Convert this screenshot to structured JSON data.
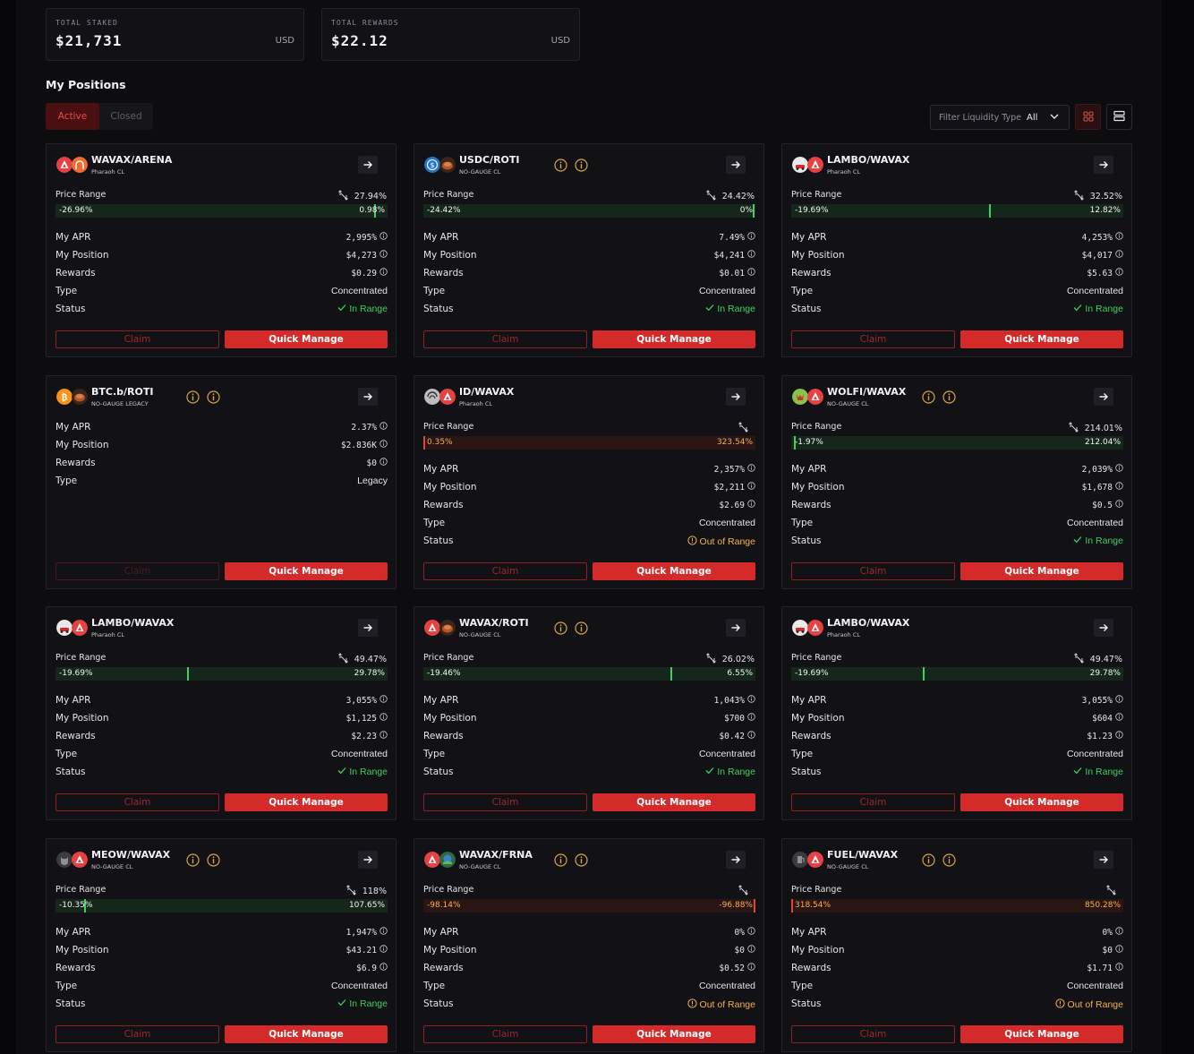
{
  "summary": {
    "staked": {
      "label": "TOTAL STAKED",
      "value": "$21,731",
      "unit": "USD"
    },
    "rewards": {
      "label": "TOTAL REWARDS",
      "value": "$22.12",
      "unit": "USD"
    }
  },
  "title": "My Positions",
  "tabs": {
    "active": "Active",
    "closed": "Closed"
  },
  "filter": {
    "label": "Filter Liquidity Type",
    "value": "All"
  },
  "labels": {
    "price_range": "Price Range",
    "apr": "My APR",
    "position": "My Position",
    "rewards": "Rewards",
    "type": "Type",
    "status": "Status",
    "claim": "Claim",
    "quick_manage": "Quick Manage"
  },
  "colors": {
    "accent": "#d42a2a",
    "in_range": "#3ed15e",
    "out_of_range": "#f5b14c",
    "background": "#0d0d10",
    "card": "#111116"
  },
  "positions": [
    {
      "pair": "WAVAX/ARENA",
      "sub": "Pharaoh CL",
      "tokens": [
        "avax",
        "arena"
      ],
      "info_icons": false,
      "range": {
        "width": "27.94%",
        "low": "-26.96%",
        "high": "0.98%",
        "in_range": true,
        "marker": 0.964
      },
      "apr": "2,995%",
      "position": "$4,273",
      "rewards": "$0.29",
      "type": "Concentrated",
      "status": "In Range",
      "status_ok": true,
      "claim_enabled": true
    },
    {
      "pair": "USDC/ROTI",
      "sub": "NO-GAUGE CL",
      "tokens": [
        "usdc",
        "roti"
      ],
      "info_icons": true,
      "range": {
        "width": "24.42%",
        "low": "-24.42%",
        "high": "0%",
        "in_range": true,
        "marker": 0.996
      },
      "apr": "7.49%",
      "position": "$4,241",
      "rewards": "$0.01",
      "type": "Concentrated",
      "status": "In Range",
      "status_ok": true,
      "claim_enabled": true
    },
    {
      "pair": "LAMBO/WAVAX",
      "sub": "Pharaoh CL",
      "tokens": [
        "lambo",
        "avax"
      ],
      "info_icons": false,
      "range": {
        "width": "32.52%",
        "low": "-19.69%",
        "high": "12.82%",
        "in_range": true,
        "marker": 0.599
      },
      "apr": "4,253%",
      "position": "$4,017",
      "rewards": "$5.63",
      "type": "Concentrated",
      "status": "In Range",
      "status_ok": true,
      "claim_enabled": true
    },
    {
      "pair": "BTC.b/ROTI",
      "sub": "NO-GAUGE LEGACY",
      "tokens": [
        "btc",
        "roti"
      ],
      "info_icons": true,
      "range": null,
      "apr": "2.37%",
      "position": "$2.836K",
      "rewards": "$0",
      "type": "Legacy",
      "status": null,
      "status_ok": true,
      "claim_enabled": false
    },
    {
      "pair": "ID/WAVAX",
      "sub": "Pharaoh CL",
      "tokens": [
        "id",
        "avax"
      ],
      "info_icons": false,
      "range": {
        "width": "",
        "low": "0.35%",
        "high": "323.54%",
        "in_range": false,
        "marker": 0.0
      },
      "apr": "2,357%",
      "position": "$2,211",
      "rewards": "$2.69",
      "type": "Concentrated",
      "status": "Out of Range",
      "status_ok": false,
      "claim_enabled": true
    },
    {
      "pair": "WOLFI/WAVAX",
      "sub": "NO-GAUGE CL",
      "tokens": [
        "wolfi",
        "avax"
      ],
      "info_icons": true,
      "range": {
        "width": "214.01%",
        "low": "-1.97%",
        "high": "212.04%",
        "in_range": true,
        "marker": 0.009
      },
      "apr": "2,039%",
      "position": "$1,678",
      "rewards": "$0.5",
      "type": "Concentrated",
      "status": "In Range",
      "status_ok": true,
      "claim_enabled": true
    },
    {
      "pair": "LAMBO/WAVAX",
      "sub": "Pharaoh CL",
      "tokens": [
        "lambo",
        "avax"
      ],
      "info_icons": false,
      "range": {
        "width": "49.47%",
        "low": "-19.69%",
        "high": "29.78%",
        "in_range": true,
        "marker": 0.398
      },
      "apr": "3,055%",
      "position": "$1,125",
      "rewards": "$2.23",
      "type": "Concentrated",
      "status": "In Range",
      "status_ok": true,
      "claim_enabled": true
    },
    {
      "pair": "WAVAX/ROTI",
      "sub": "NO-GAUGE CL",
      "tokens": [
        "avax",
        "roti"
      ],
      "info_icons": true,
      "range": {
        "width": "26.02%",
        "low": "-19.46%",
        "high": "6.55%",
        "in_range": true,
        "marker": 0.748
      },
      "apr": "1,043%",
      "position": "$700",
      "rewards": "$0.42",
      "type": "Concentrated",
      "status": "In Range",
      "status_ok": true,
      "claim_enabled": true
    },
    {
      "pair": "LAMBO/WAVAX",
      "sub": "Pharaoh CL",
      "tokens": [
        "lambo",
        "avax"
      ],
      "info_icons": false,
      "range": {
        "width": "49.47%",
        "low": "-19.69%",
        "high": "29.78%",
        "in_range": true,
        "marker": 0.398
      },
      "apr": "3,055%",
      "position": "$604",
      "rewards": "$1.23",
      "type": "Concentrated",
      "status": "In Range",
      "status_ok": true,
      "claim_enabled": true
    },
    {
      "pair": "MEOW/WAVAX",
      "sub": "NO-GAUGE CL",
      "tokens": [
        "meow",
        "avax"
      ],
      "info_icons": true,
      "range": {
        "width": "118%",
        "low": "-10.35%",
        "high": "107.65%",
        "in_range": true,
        "marker": 0.088
      },
      "apr": "1,947%",
      "position": "$43.21",
      "rewards": "$6.9",
      "type": "Concentrated",
      "status": "In Range",
      "status_ok": true,
      "claim_enabled": true
    },
    {
      "pair": "WAVAX/FRNA",
      "sub": "NO-GAUGE CL",
      "tokens": [
        "avax",
        "frna"
      ],
      "info_icons": true,
      "range": {
        "width": "",
        "low": "-98.14%",
        "high": "-96.88%",
        "in_range": false,
        "marker": 1.0
      },
      "apr": "0%",
      "position": "$0",
      "rewards": "$0.52",
      "type": "Concentrated",
      "status": "Out of Range",
      "status_ok": false,
      "claim_enabled": true
    },
    {
      "pair": "FUEL/WAVAX",
      "sub": "NO-GAUGE CL",
      "tokens": [
        "fuel",
        "avax"
      ],
      "info_icons": true,
      "range": {
        "width": "",
        "low": "318.54%",
        "high": "850.28%",
        "in_range": false,
        "marker": 0.0
      },
      "apr": "0%",
      "position": "$0",
      "rewards": "$1.71",
      "type": "Concentrated",
      "status": "Out of Range",
      "status_ok": false,
      "claim_enabled": true
    }
  ]
}
